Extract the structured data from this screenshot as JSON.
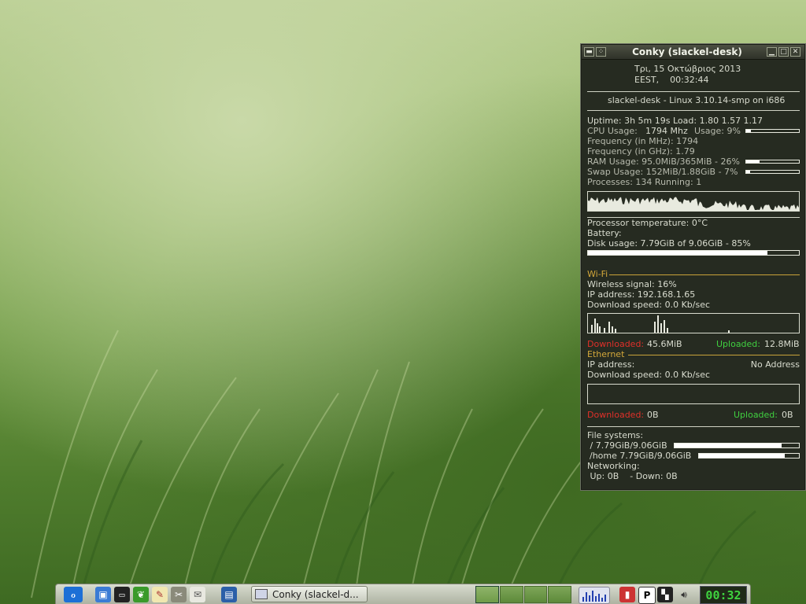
{
  "conky": {
    "title": "Conky (slackel-desk)",
    "date_line": "Τρι,  15 Οκτώβριος 2013",
    "time_line": "EEST,    00:32:44",
    "host_line": "slackel-desk - Linux 3.10.14-smp on i686",
    "uptime": "Uptime: 3h 5m 19s Load: 1.80 1.57 1.17",
    "cpu_label": "CPU Usage:",
    "cpu_mhz": "1794 Mhz",
    "cpu_usage": "Usage: 9%",
    "cpu_percent": 9,
    "freq_mhz": "Frequency (in MHz): 1794",
    "freq_ghz": "Frequency (in GHz): 1.79",
    "ram": "RAM Usage: 95.0MiB/365MiB - 26%",
    "ram_percent": 26,
    "swap": "Swap Usage: 152MiB/1.88GiB - 7%",
    "swap_percent": 7,
    "processes": "Processes: 134  Running: 1",
    "temp": "Processor temperature: 0°C",
    "battery": "Battery:",
    "disk": "Disk usage: 7.79GiB of 9.06GiB - 85%",
    "disk_percent": 85,
    "wifi_header": "Wi-Fi",
    "wifi_signal": "Wireless signal: 16%",
    "wifi_ip": "IP address: 192.168.1.65",
    "wifi_down_speed": "Download speed: 0.0 Kb/sec",
    "wifi_downloaded_label": "Downloaded:",
    "wifi_downloaded": "45.6MiB",
    "wifi_uploaded_label": "Uploaded:",
    "wifi_uploaded": "12.8MiB",
    "eth_header": "Ethernet",
    "eth_ip_label": "IP address:",
    "eth_ip": "No Address",
    "eth_down_speed": "Download speed: 0.0 Kb/sec",
    "eth_downloaded_label": "Downloaded:",
    "eth_downloaded": "0B",
    "eth_uploaded_label": "Uploaded:",
    "eth_uploaded": "0B",
    "fs_header": "File systems:",
    "fs_root": " / 7.79GiB/9.06GiB",
    "fs_root_percent": 86,
    "fs_home": "/home 7.79GiB/9.06GiB",
    "fs_home_percent": 86,
    "net_header": "Networking:",
    "net_line": " Up: 0B    - Down: 0B"
  },
  "taskbar": {
    "task_label": "Conky (slackel-d...",
    "clock": "00:32"
  },
  "colors": {
    "downloaded": "#e0302a",
    "uploaded": "#40d040",
    "section": "#d4a83a",
    "clock": "#3fd23f"
  }
}
